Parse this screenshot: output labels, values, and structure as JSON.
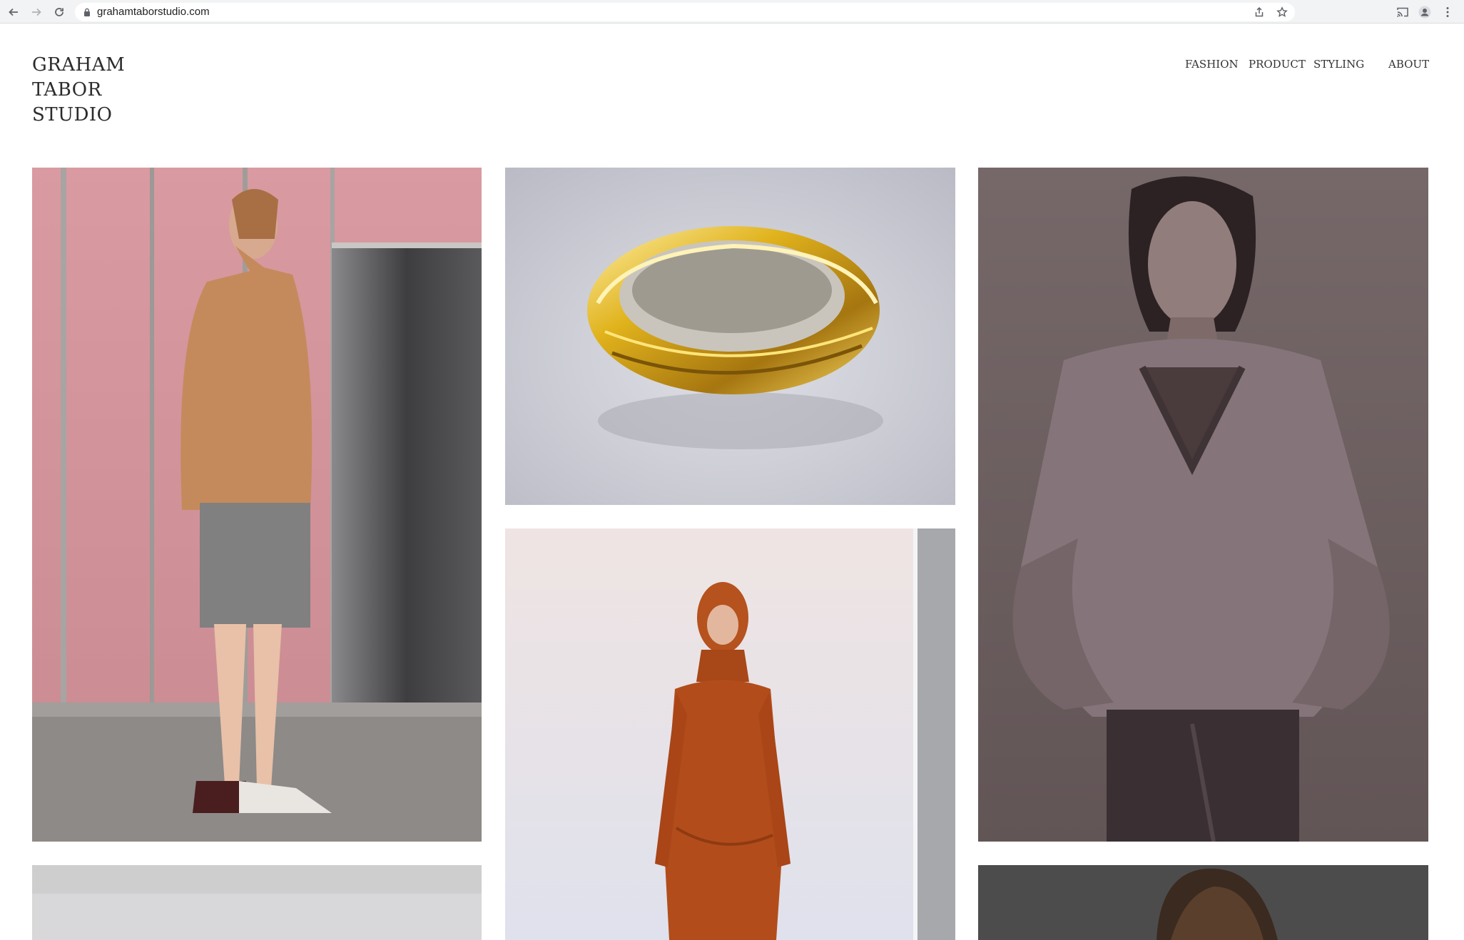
{
  "browser": {
    "url": "grahamtaborstudio.com",
    "icons": [
      "back-icon",
      "forward-icon",
      "reload-icon",
      "lock-icon",
      "share-icon",
      "star-icon",
      "cast-icon",
      "profile-icon",
      "menu-icon"
    ]
  },
  "site": {
    "logo": [
      "GRAHAM",
      "TABOR",
      "STUDIO"
    ],
    "nav": [
      {
        "label": "FASHION"
      },
      {
        "label": "PRODUCT"
      },
      {
        "label": "STYLING"
      },
      {
        "label": "ABOUT"
      }
    ]
  },
  "colors": {
    "chrome_bg": "#f1f3f4",
    "page_bg": "#ffffff",
    "text": "#2b2b2b"
  }
}
